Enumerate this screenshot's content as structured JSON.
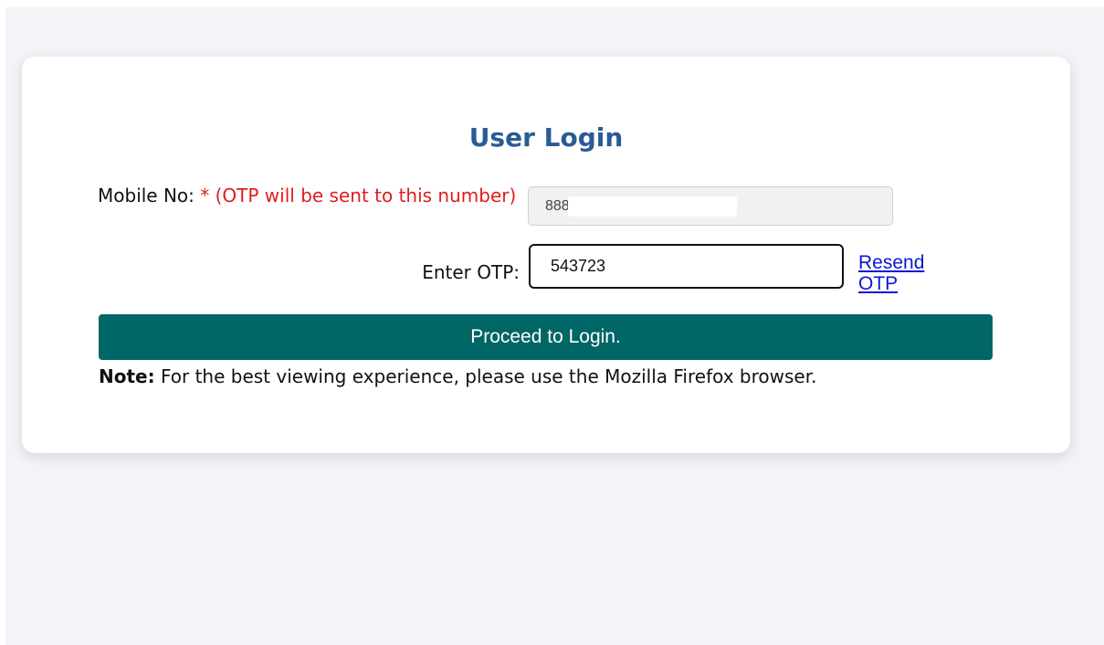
{
  "login": {
    "title": "User Login",
    "mobile": {
      "label": "Mobile No: ",
      "required_marker": "* (OTP will be sent to this number)",
      "value": "888"
    },
    "otp": {
      "label": "Enter OTP:",
      "value": "543723"
    },
    "resend_label": "Resend OTP",
    "submit_label": "Proceed to Login.",
    "note": {
      "prefix": "Note:",
      "text": " For the best viewing experience, please use the Mozilla Firefox browser."
    }
  },
  "colors": {
    "title": "#2a5b96",
    "required": "#e01c1c",
    "button": "#006666",
    "link": "#0b16d8",
    "page_background": "#f3f3f8"
  }
}
